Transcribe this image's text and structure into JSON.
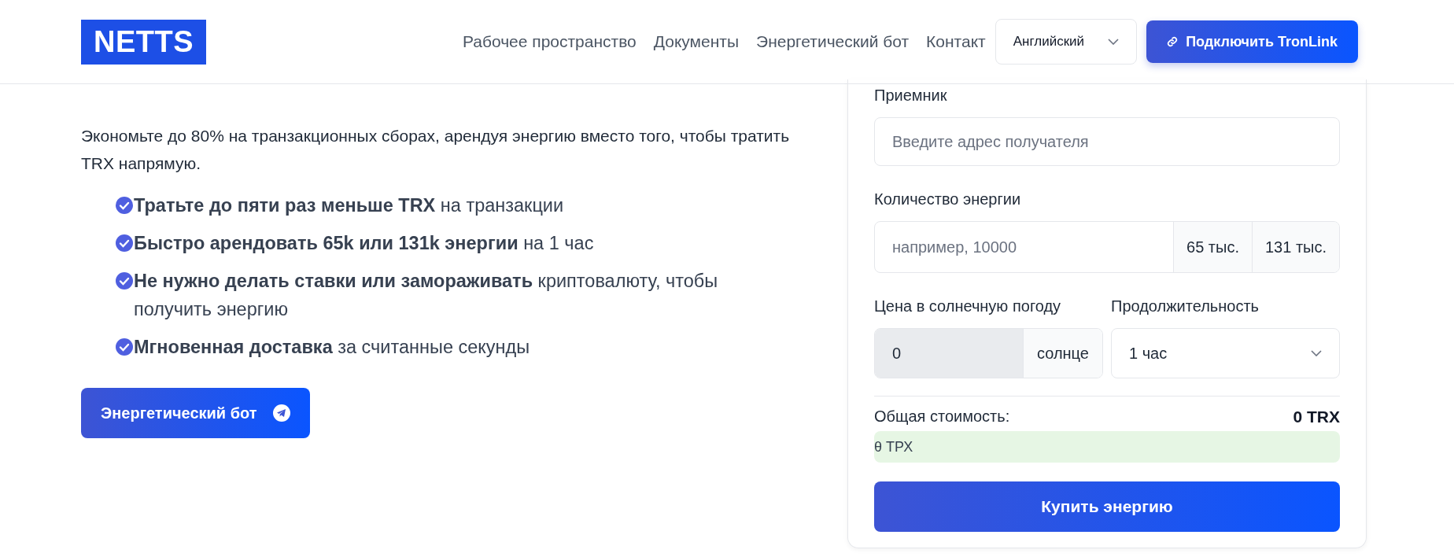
{
  "header": {
    "logo": "NETTS",
    "nav": [
      "Рабочее пространство",
      "Документы",
      "Энергетический бот",
      "Контакт"
    ],
    "language": "Английский",
    "connect_button": "Подключить TronLink"
  },
  "intro": {
    "text": "Экономьте до 80% на транзакционных сборах, арендуя энергию вместо того, чтобы тратить TRX напрямую.",
    "features": [
      "**Тратьте до пяти раз меньше TRX** на транзакции",
      "**Быстро арендовать 65k или 131k энергии** на 1 час",
      "**Не нужно делать ставки или замораживать** криптовалюту, чтобы получить энергию",
      "**Мгновенная доставка** за считанные секунды"
    ],
    "bot_button": "Энергетический бот"
  },
  "form": {
    "recipient": {
      "label": "Приемник",
      "placeholder": "Введите адрес получателя"
    },
    "energy": {
      "label": "Количество энергии",
      "placeholder": "например, 10000",
      "presets": [
        "65 тыс.",
        "131 тыс."
      ]
    },
    "price": {
      "label": "Цена в солнечную погоду",
      "value": "0",
      "unit": "солнце"
    },
    "duration": {
      "label": "Продолжительность",
      "value": "1 час"
    },
    "total": {
      "label": "Общая стоимость:",
      "value": "0 TRX",
      "converted": "θ ТРХ"
    },
    "buy_button": "Купить энергию"
  }
}
